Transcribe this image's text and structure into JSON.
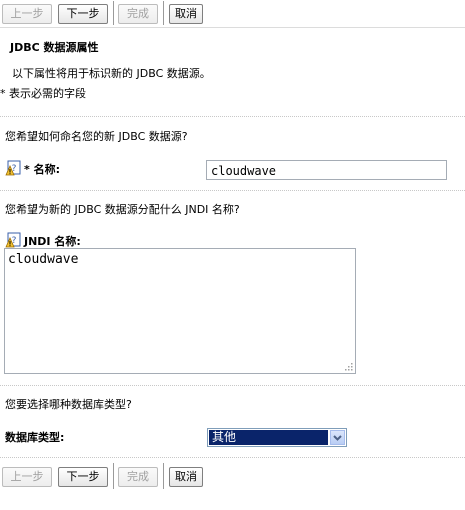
{
  "toolbar": {
    "prev": "上一步",
    "next": "下一步",
    "finish": "完成",
    "cancel": "取消"
  },
  "header": {
    "title": "JDBC 数据源属性",
    "description": "以下属性将用于标识新的 JDBC 数据源。",
    "required_note": "* 表示必需的字段"
  },
  "name_section": {
    "question": "您希望如何命名您的新 JDBC 数据源?",
    "label": "* 名称:",
    "value": "cloudwave"
  },
  "jndi_section": {
    "question": "您希望为新的 JDBC 数据源分配什么 JNDI 名称?",
    "label": "JNDI 名称:",
    "value": "cloudwave"
  },
  "dbtype_section": {
    "question": "您要选择哪种数据库类型?",
    "label": "数据库类型:",
    "selected": "其他"
  },
  "colors": {
    "button_border": "#7f7f7f",
    "disabled_text": "#a0a0a0",
    "select_highlight": "#0a246a"
  }
}
